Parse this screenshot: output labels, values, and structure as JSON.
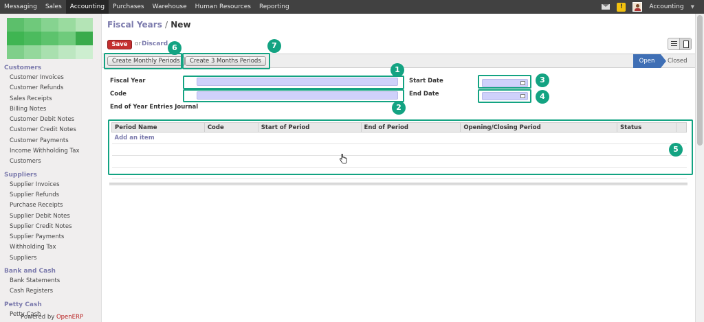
{
  "topnav": {
    "items": [
      "Messaging",
      "Sales",
      "Accounting",
      "Purchases",
      "Warehouse",
      "Human Resources",
      "Reporting"
    ],
    "active": "Accounting",
    "user": "Accounting"
  },
  "sidebar": {
    "sections": [
      {
        "title": "Customers",
        "items": [
          "Customer Invoices",
          "Customer Refunds",
          "Sales Receipts",
          "Billing Notes",
          "Customer Debit Notes",
          "Customer Credit Notes",
          "Customer Payments",
          "Income Withholding Tax",
          "Customers"
        ]
      },
      {
        "title": "Suppliers",
        "items": [
          "Supplier Invoices",
          "Supplier Refunds",
          "Purchase Receipts",
          "Supplier Debit Notes",
          "Supplier Credit Notes",
          "Supplier Payments",
          "Withholding Tax",
          "Suppliers"
        ]
      },
      {
        "title": "Bank and Cash",
        "items": [
          "Bank Statements",
          "Cash Registers"
        ]
      },
      {
        "title": "Petty Cash",
        "items": [
          "Petty Cash"
        ]
      }
    ],
    "powered_prefix": "Powered by",
    "powered_brand": "OpenERP",
    "logo_colors": [
      "#5cbf6b",
      "#6fc97b",
      "#86d390",
      "#9adb9f",
      "#b4e4b6",
      "#3fb552",
      "#4cbb5e",
      "#5dc36d",
      "#6fcb7c",
      "#3aab4c",
      "#7fcf8a",
      "#94d89c",
      "#a9e0af",
      "#bde7c1",
      "#cdeed0"
    ]
  },
  "breadcrumb": {
    "parent": "Fiscal Years",
    "separator": "/",
    "current": "New"
  },
  "toolbar": {
    "save_label": "Save",
    "or_text": "or",
    "discard_label": "Discard"
  },
  "statusbar": {
    "buttons": [
      "Create Monthly Periods",
      "Create 3 Months Periods"
    ],
    "stages": [
      "Open",
      "Closed"
    ],
    "active_stage": "Open"
  },
  "form": {
    "fiscal_year_label": "Fiscal Year",
    "code_label": "Code",
    "end_journal_label": "End of Year Entries Journal",
    "start_date_label": "Start Date",
    "end_date_label": "End Date",
    "fiscal_year_value": "",
    "code_value": "",
    "start_date_value": "",
    "end_date_value": ""
  },
  "periods_table": {
    "columns": [
      "Period Name",
      "Code",
      "Start of Period",
      "End of Period",
      "Opening/Closing Period",
      "Status"
    ],
    "add_item_label": "Add an item"
  },
  "annotations": [
    "1",
    "2",
    "3",
    "4",
    "5",
    "6",
    "7"
  ],
  "colors": {
    "accent": "#13a382",
    "link": "#7c7bad",
    "save": "#c42f2f",
    "stage_active": "#3f6fb5",
    "input_required": "#cfd1fb"
  }
}
